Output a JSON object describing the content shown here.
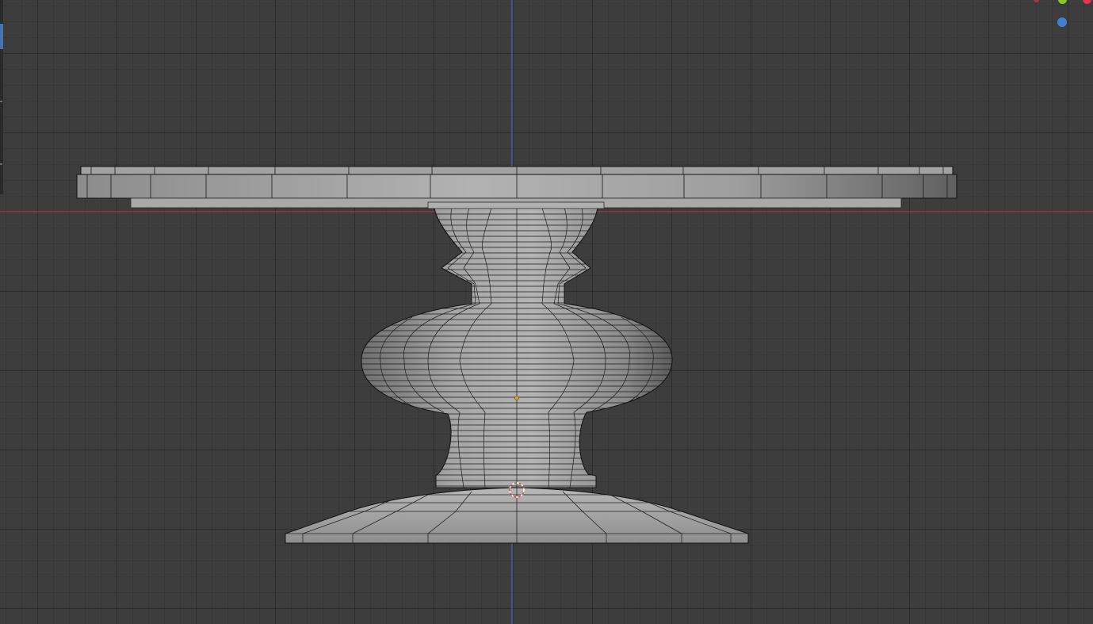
{
  "viewport": {
    "background": "#3d3d3d",
    "x_axis_color": "#b4404d",
    "y_axis_color": "#4a79c0",
    "origin_color": "#f39c1f",
    "cursor_color": "#e04a33",
    "mesh_shade": "#9a9a9a",
    "wire_color": "#111111"
  },
  "gizmo": {
    "x_color": "#e2354f",
    "y_color": "#8bc72a",
    "z_color": "#3f7fcf"
  },
  "toolbar": {
    "active_color": "#4772b3"
  },
  "object": {
    "name_icon": "3d-cursor-icon"
  }
}
